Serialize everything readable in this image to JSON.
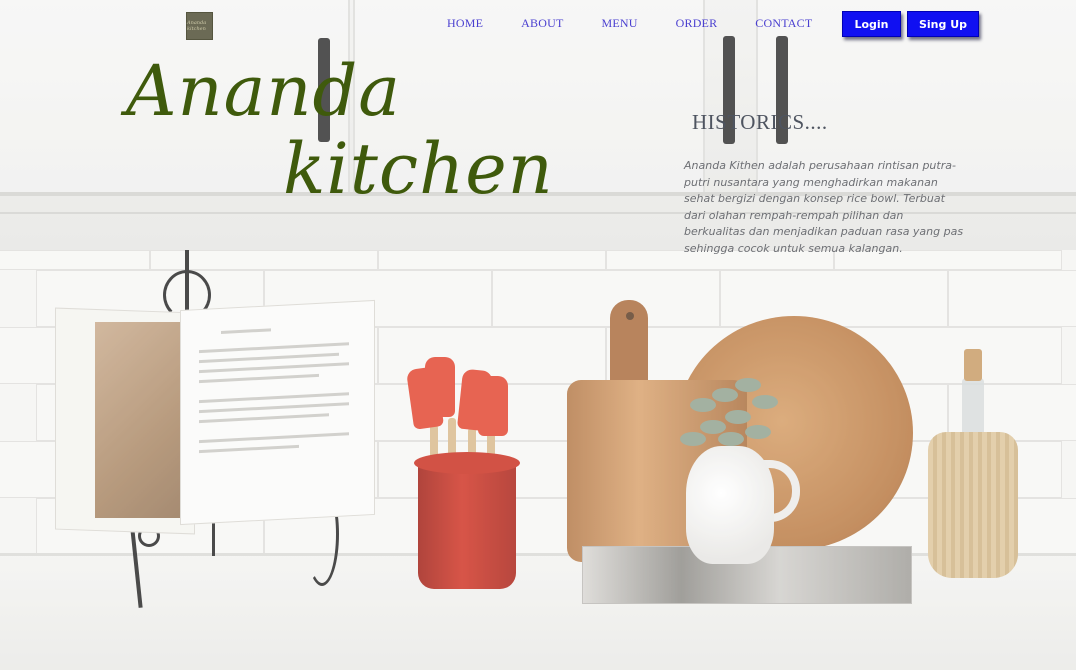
{
  "nav": {
    "logo_text": "Ananda kitchen",
    "links": [
      "HOME",
      "ABOUT",
      "MENU",
      "ORDER",
      "CONTACT"
    ],
    "login_label": "Login",
    "signup_label": "Sing Up"
  },
  "hero": {
    "brand_line1": "Ananda",
    "brand_line2": "kitchen"
  },
  "history": {
    "title": "HISTORICS....",
    "body": "Ananda Kithen adalah perusahaan rintisan putra-putri nusantara yang menghadirkan makanan sehat bergizi dengan konsep rice bowl. Terbuat dari olahan rempah-rempah pilihan dan berkualitas dan menjadikan paduan rasa yang pas sehingga cocok untuk semua kalangan."
  },
  "colors": {
    "brand_text": "#3f5a0c",
    "nav_link": "#4a3fd0",
    "button_bg": "#1010f2",
    "button_text": "#ffffff"
  },
  "background": {
    "description_icon": "kitchen-counter-photo"
  }
}
